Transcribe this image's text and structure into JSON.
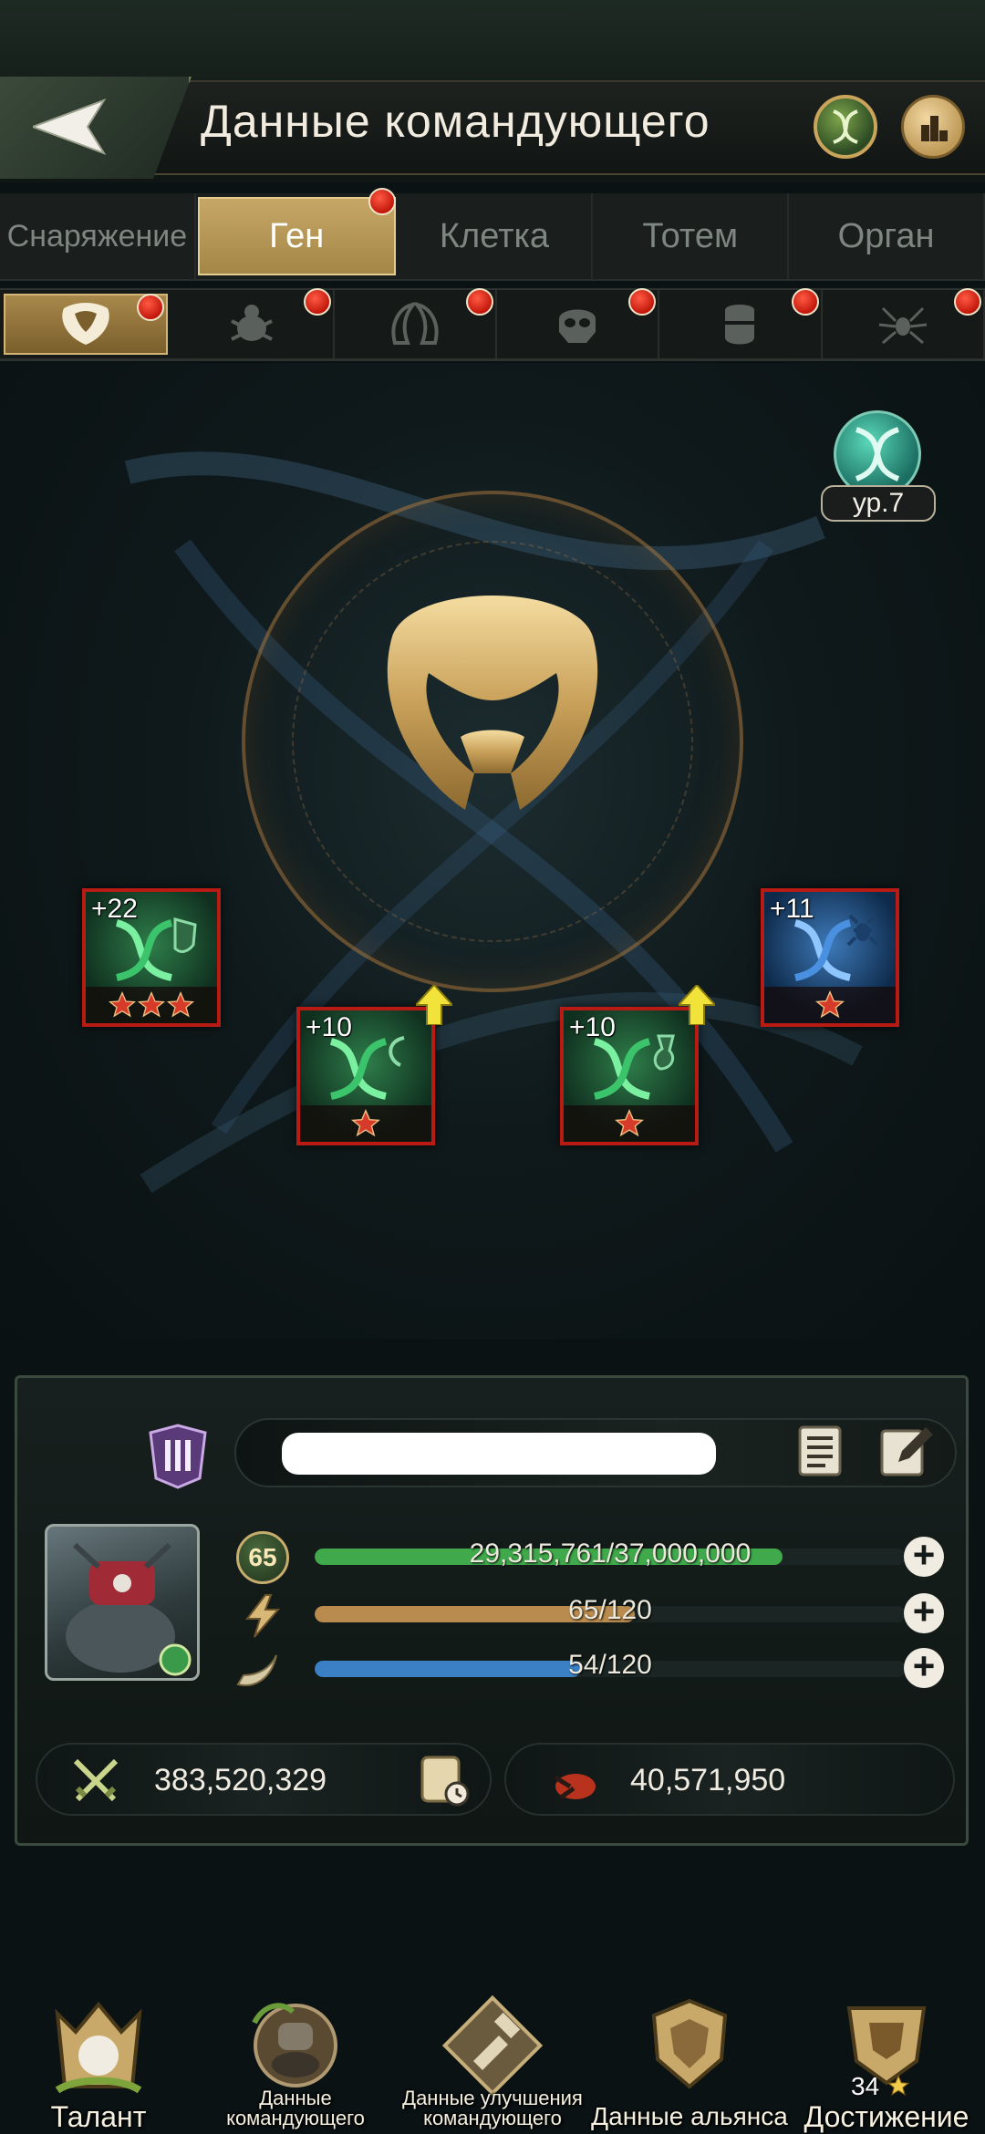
{
  "header": {
    "title": "Данные командующего",
    "back_icon": "back-arrow-icon",
    "gene_icon": "gene-icon",
    "ranking_icon": "ranking-icon"
  },
  "tabs": [
    {
      "label": "Снаряжение",
      "active": false,
      "badge": false
    },
    {
      "label": "Ген",
      "active": true,
      "badge": true
    },
    {
      "label": "Клетка",
      "active": false,
      "badge": false
    },
    {
      "label": "Тотем",
      "active": false,
      "badge": false
    },
    {
      "label": "Орган",
      "active": false,
      "badge": false
    }
  ],
  "subtabs": [
    {
      "icon": "horn-mask-icon",
      "active": true,
      "badge": true
    },
    {
      "icon": "beetle-icon",
      "active": false,
      "badge": true
    },
    {
      "icon": "mandible-icon",
      "active": false,
      "badge": true
    },
    {
      "icon": "skull-icon",
      "active": false,
      "badge": true
    },
    {
      "icon": "shield-head-icon",
      "active": false,
      "badge": true
    },
    {
      "icon": "spider-icon",
      "active": false,
      "badge": true
    }
  ],
  "gene_level": {
    "label": "ур.7"
  },
  "gene_slots": [
    {
      "level": "+22",
      "stars": 3,
      "color": "green",
      "upgrade": false
    },
    {
      "level": "+10",
      "stars": 1,
      "color": "green",
      "upgrade": true
    },
    {
      "level": "+10",
      "stars": 1,
      "color": "green",
      "upgrade": true
    },
    {
      "level": "+11",
      "stars": 1,
      "color": "blue",
      "upgrade": false
    }
  ],
  "profile": {
    "player_name": "",
    "level": "65",
    "exp_text": "29,315,761/37,000,000",
    "exp_fraction": 0.792,
    "stamina_text": "65/120",
    "stamina_fraction": 0.542,
    "energy_text": "54/120",
    "energy_fraction": 0.45,
    "power": "383,520,329",
    "kills": "40,571,950"
  },
  "bottom_nav": {
    "talent": "Талант",
    "commander_data": "Данные командующего",
    "upgrade_data": "Данные улучшения командующего",
    "alliance_data": "Данные альянса",
    "achievement": "Достижение",
    "achievement_count": "34"
  },
  "colors": {
    "exp_bar": "#3fa94b",
    "stamina_bar": "#b98b4f",
    "energy_bar": "#3b7fc4",
    "active_tab": "#c6a766",
    "badge_red": "#d42a17"
  }
}
